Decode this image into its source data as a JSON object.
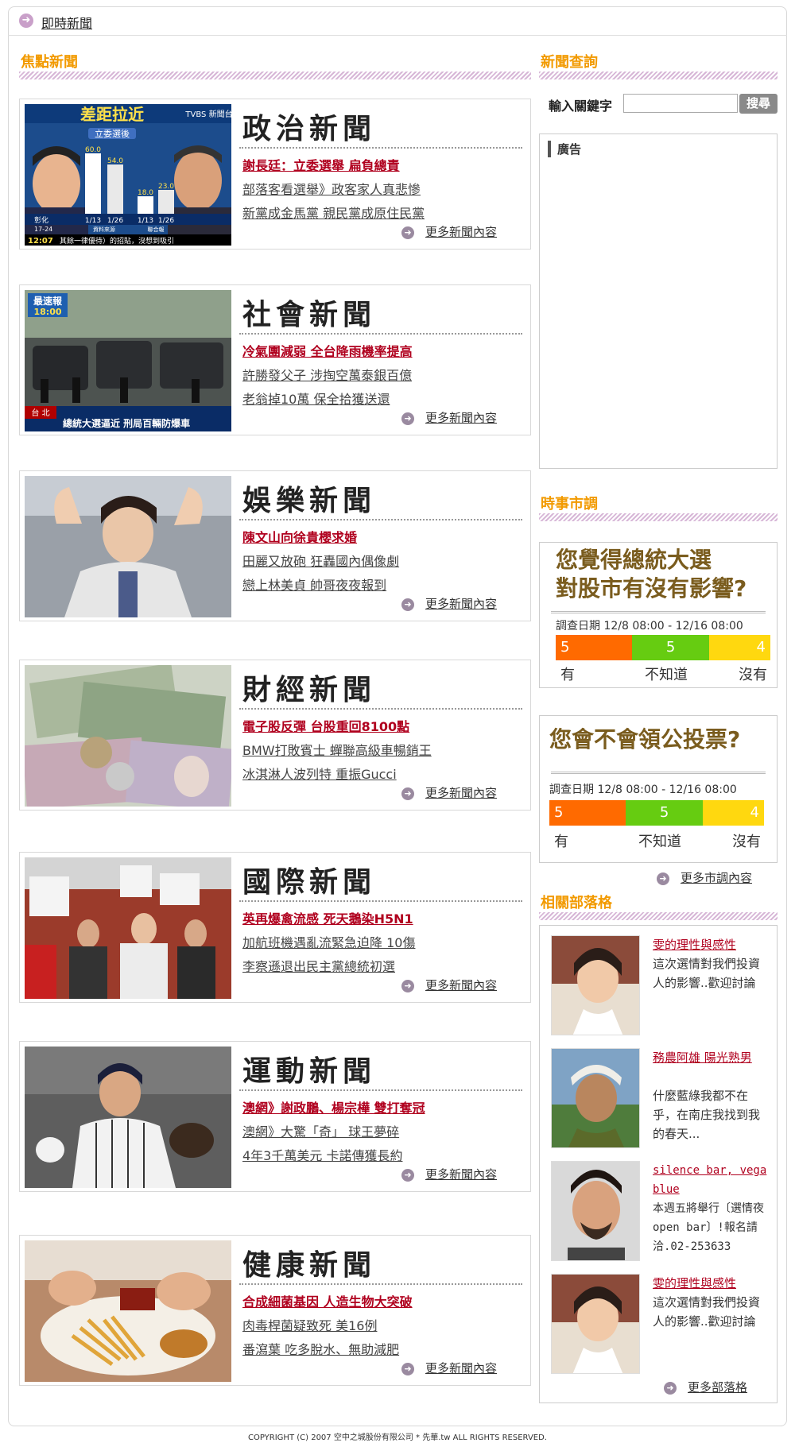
{
  "topbar": {
    "label": "即時新聞"
  },
  "sections": {
    "focus": "焦點新聞",
    "search": "新聞查詢",
    "poll": "時事市調",
    "blogs": "相關部落格"
  },
  "news": [
    {
      "category": "政治新聞",
      "headlines": [
        "謝長廷：立委選舉 扁負總責",
        "部落客看選舉》政客家人真悲慘",
        "新黨成金馬黨 親民黨成原住民黨"
      ],
      "more": "更多新聞內容"
    },
    {
      "category": "社會新聞",
      "headlines": [
        "冷氣團減弱 全台降雨機率提高",
        "許勝發父子 涉掏空萬泰銀百億",
        "老翁掉10萬 保全拾獲送還"
      ],
      "more": "更多新聞內容"
    },
    {
      "category": "娛樂新聞",
      "headlines": [
        "陳文山向徐貴櫻求婚",
        "田麗又放砲 狂轟國內偶像劇",
        "戀上林美貞 帥哥夜夜報到"
      ],
      "more": "更多新聞內容"
    },
    {
      "category": "財經新聞",
      "headlines": [
        "電子股反彈 台股重回8100點",
        "BMW打敗賓士 蟬聯高級車暢銷王",
        "冰淇淋人波列特 重振Gucci"
      ],
      "more": "更多新聞內容"
    },
    {
      "category": "國際新聞",
      "headlines": [
        "英再爆禽流感 死天鵝染H5N1",
        "加航班機遇亂流緊急迫降 10傷",
        "李察遜退出民主黨總統初選"
      ],
      "more": "更多新聞內容"
    },
    {
      "category": "運動新聞",
      "headlines": [
        "澳網》謝政鵬、楊宗樺 雙打奪冠",
        "澳網》大驚「奇」 球王夢碎",
        "4年3千萬美元 卡諾傳獲長約"
      ],
      "more": "更多新聞內容"
    },
    {
      "category": "健康新聞",
      "headlines": [
        "合成細菌基因 人造生物大突破",
        "肉毒桿菌疑致死 美16例",
        "番瀉葉 吃多脫水、無助減肥"
      ],
      "more": "更多新聞內容"
    }
  ],
  "photo1": {
    "banner": "差距拉近",
    "subbanner": "立委選後",
    "channel": "TVBS 新聞台",
    "bars": [
      "60.0",
      "54.0",
      "18.0",
      "23.0"
    ],
    "dates": [
      "1/13",
      "1/26",
      "1/13",
      "1/26"
    ],
    "source": "資料來源",
    "org": "聯合報",
    "time": "12:07",
    "ticker": "其餘一律優待）的招貼，沒想到吸引",
    "city": "彰化",
    "temp": "17-24"
  },
  "photo2": {
    "tag": "最速報",
    "clock": "18:00",
    "city": "台 北",
    "ticker": "總統大選逼近 刑局百輛防爆車"
  },
  "search": {
    "label": "輸入關鍵字",
    "placeholder": "",
    "button": "搜尋"
  },
  "ad": {
    "label": "廣告"
  },
  "polls": [
    {
      "question_l1": "您覺得總統大選",
      "question_l2": "對股市有沒有影響?",
      "date": "調查日期 12/8 08:00 - 12/16 08:00",
      "values": [
        5,
        5,
        4
      ],
      "options": [
        "有",
        "不知道",
        "沒有"
      ],
      "colors": [
        "#ff6a00",
        "#66cc11",
        "#ffd80f"
      ]
    },
    {
      "question_l1": "您會不會領公投票?",
      "question_l2": "",
      "date": "調查日期 12/8 08:00 - 12/16 08:00",
      "values": [
        5,
        5,
        4
      ],
      "options": [
        "有",
        "不知道",
        "沒有"
      ],
      "colors": [
        "#ff6a00",
        "#66cc11",
        "#ffd80f"
      ]
    }
  ],
  "poll_more": "更多市調內容",
  "blogs": [
    {
      "title": "雯的理性與感性",
      "desc": "這次選情對我們投資人的影響..歡迎討論"
    },
    {
      "title": "務農阿雄 陽光熟男",
      "desc": "什麼藍綠我都不在乎，在南庄我找到我的春天..."
    },
    {
      "title": "silence bar, vega blue",
      "desc": "本週五將舉行〔選情夜open bar〕!報名請洽.02-253633"
    },
    {
      "title": "雯的理性與感性",
      "desc": "這次選情對我們投資人的影響..歡迎討論"
    }
  ],
  "blogs_more": "更多部落格",
  "footer": "COPYRIGHT (C) 2007 空中之城股份有限公司 * 先華.tw ALL RIGHTS RESERVED."
}
